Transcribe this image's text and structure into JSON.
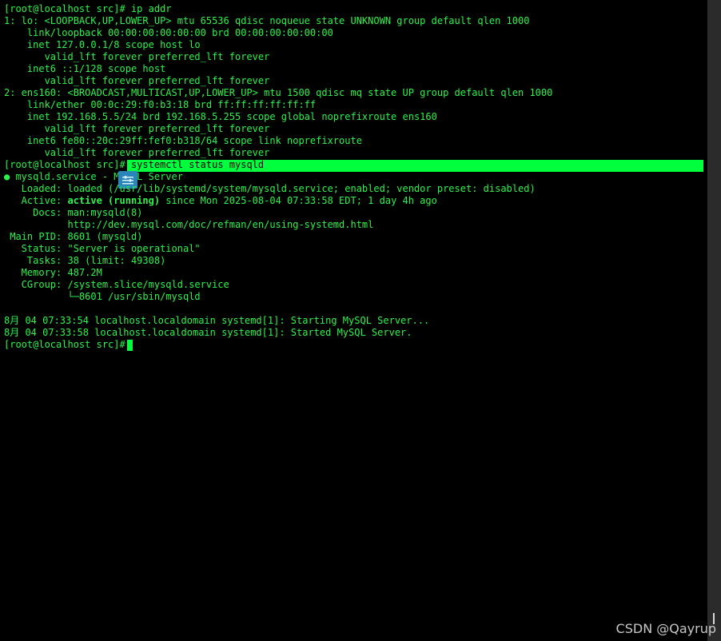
{
  "terminal": {
    "lines": [
      "[root@localhost src]# ip addr",
      "1: lo: <LOOPBACK,UP,LOWER_UP> mtu 65536 qdisc noqueue state UNKNOWN group default qlen 1000",
      "    link/loopback 00:00:00:00:00:00 brd 00:00:00:00:00:00",
      "    inet 127.0.0.1/8 scope host lo",
      "       valid_lft forever preferred_lft forever",
      "    inet6 ::1/128 scope host",
      "       valid_lft forever preferred_lft forever",
      "2: ens160: <BROADCAST,MULTICAST,UP,LOWER_UP> mtu 1500 qdisc mq state UP group default qlen 1000",
      "    link/ether 00:0c:29:f0:b3:18 brd ff:ff:ff:ff:ff:ff",
      "    inet 192.168.5.5/24 brd 192.168.5.255 scope global noprefixroute ens160",
      "       valid_lft forever preferred_lft forever",
      "    inet6 fe80::20c:29ff:fef0:b318/64 scope link noprefixroute",
      "       valid_lft forever preferred_lft forever"
    ],
    "command_prompt": "[root@localhost src]# ",
    "command_text": "systemctl status mysqld",
    "service_line": "● mysqld.service - MySQL Server",
    "loaded_line": "   Loaded: loaded (/usr/lib/systemd/system/mysqld.service; enabled; vendor preset: disabled)",
    "active_label": "   Active: ",
    "active_state": "active (running)",
    "active_rest": " since Mon 2025-08-04 07:33:58 EDT; 1 day 4h ago",
    "docs_line": "     Docs: man:mysqld(8)",
    "docs_url_line": "           http://dev.mysql.com/doc/refman/en/using-systemd.html",
    "main_pid_line": " Main PID: 8601 (mysqld)",
    "status_line": "   Status: \"Server is operational\"",
    "tasks_line": "    Tasks: 38 (limit: 49308)",
    "memory_line": "   Memory: 487.2M",
    "cgroup_line": "   CGroup: /system.slice/mysqld.service",
    "cgroup_child_line": "           └─8601 /usr/sbin/mysqld",
    "log_line_1": "8月 04 07:33:54 localhost.localdomain systemd[1]: Starting MySQL Server...",
    "log_line_2": "8月 04 07:33:58 localhost.localdomain systemd[1]: Started MySQL Server.",
    "final_prompt": "[root@localhost src]# "
  },
  "watermark": "CSDN @Qayrup",
  "colors": {
    "text": "#2df24a",
    "highlight": "#00ff3c",
    "background": "#000000"
  }
}
